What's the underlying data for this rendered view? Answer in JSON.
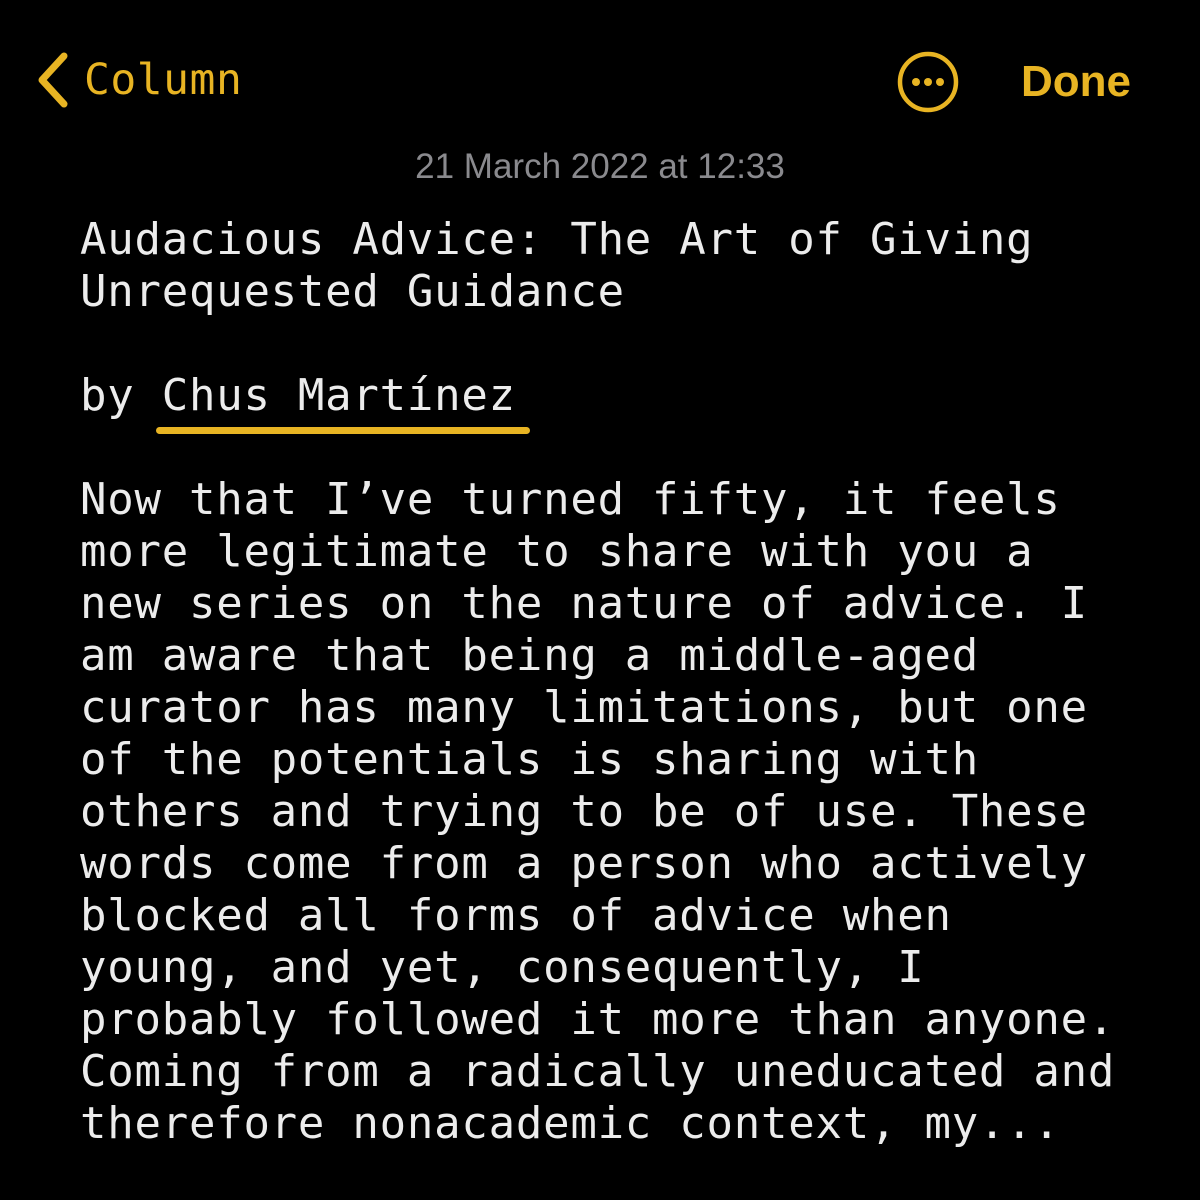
{
  "nav": {
    "back_label": "Column",
    "done_label": "Done",
    "accent_color": "#E8B423",
    "back_icon": "chevron-left-icon",
    "more_icon": "ellipsis-circle-icon"
  },
  "note": {
    "date": "21 March 2022 at 12:33",
    "title_lines": [
      "Audacious Advice: The Art of Giving",
      "Unrequested Guidance"
    ],
    "byline_prefix": "by ",
    "author": "Chus Martínez",
    "body_lines": [
      "Now that I’ve turned fifty, it feels",
      "more legitimate to share with you a",
      "new series on the nature of advice. I",
      "am aware that being a middle-aged",
      "curator has many limitations, but one",
      "of the potentials is sharing with",
      "others and trying to be of use. These",
      "words come from a person who actively",
      "blocked all forms of advice when",
      "young, and yet, consequently, I",
      "probably followed it more than anyone.",
      "Coming from a radically uneducated and",
      "therefore nonacademic context, my..."
    ]
  }
}
